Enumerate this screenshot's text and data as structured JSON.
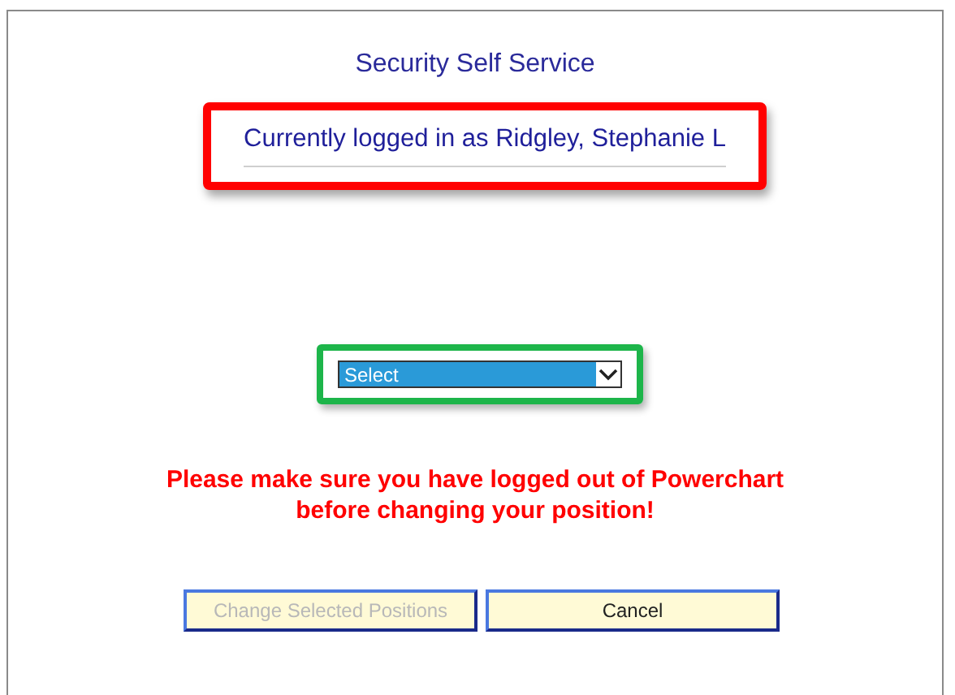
{
  "window": {
    "title": "Security Self Service"
  },
  "login_notice": {
    "text": "Currently logged in as Ridgley, Stephanie L",
    "highlighted": true
  },
  "position_select": {
    "value": "Select",
    "highlighted": true
  },
  "warning": [
    "Please make sure you have logged out of Powerchart",
    "before changing your position!"
  ],
  "buttons": [
    {
      "label": "Change Selected Positions",
      "disabled": true
    },
    {
      "label": "Cancel",
      "disabled": false
    }
  ]
}
